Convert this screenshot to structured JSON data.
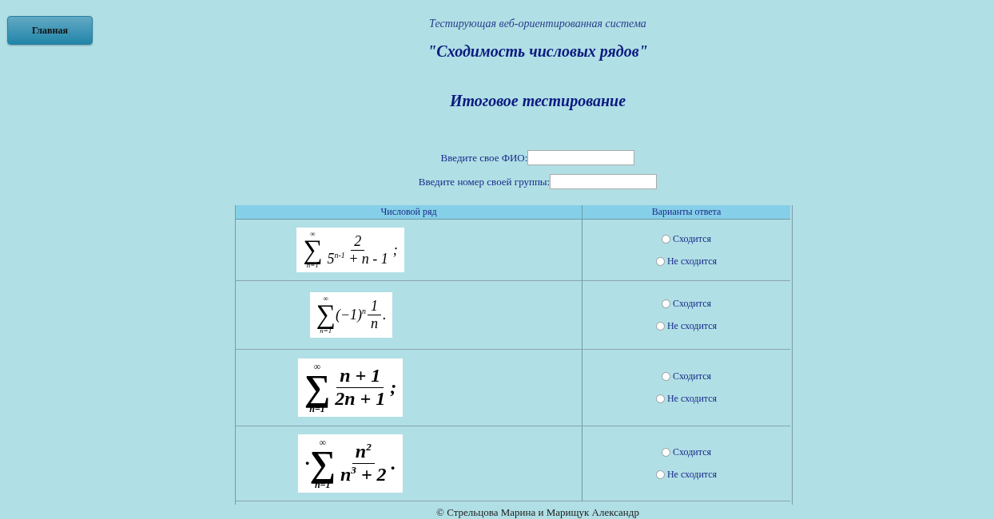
{
  "home_button": "Главная",
  "header": {
    "subtitle": "Тестирующая веб-ориентированная система",
    "title": "\"Сходимость числовых рядов\"",
    "section": "Итоговое тестирование"
  },
  "fields": [
    {
      "label": "Введите свое ФИО:"
    },
    {
      "label": "Введите номер своей группы:"
    }
  ],
  "table": {
    "columns": [
      "Числовой ряд",
      "Варианты ответа"
    ],
    "rows": [
      {
        "formula": {
          "bold": false,
          "sign": "∑",
          "upper": "∞",
          "lower": "n=1",
          "numerator": "2",
          "denominator": "5$^{n-1}$ + n - 1",
          "end": ";"
        },
        "options": [
          {
            "label": "Сходится",
            "selected": false
          },
          {
            "label": "Не сходится",
            "selected": false
          }
        ]
      },
      {
        "formula": {
          "bold": false,
          "sign": "∑",
          "upper": "∞",
          "lower": "n=1",
          "term": "(−1)$^{n}$",
          "numerator": "1",
          "denominator": "n",
          "end": "."
        },
        "options": [
          {
            "label": "Сходится",
            "selected": false
          },
          {
            "label": "Не сходится",
            "selected": false
          }
        ]
      },
      {
        "formula": {
          "bold": true,
          "sign": "∑",
          "upper": "∞",
          "lower": "n=1",
          "numerator": "n + 1",
          "denominator": "2n + 1",
          "end": ";"
        },
        "options": [
          {
            "label": "Сходится",
            "selected": false
          },
          {
            "label": "Не сходится",
            "selected": false
          }
        ]
      },
      {
        "formula": {
          "bold": true,
          "lead": "·",
          "sign": "∑",
          "upper": "∞",
          "lower": "n=1",
          "numerator": "n$^{2}$",
          "denominator": "n$^{3}$ + 2",
          "end": "."
        },
        "options": [
          {
            "label": "Сходится",
            "selected": false
          },
          {
            "label": "Не сходится",
            "selected": false
          }
        ]
      }
    ]
  },
  "footer": "© Стрельцова Марина и Марищук Александр"
}
